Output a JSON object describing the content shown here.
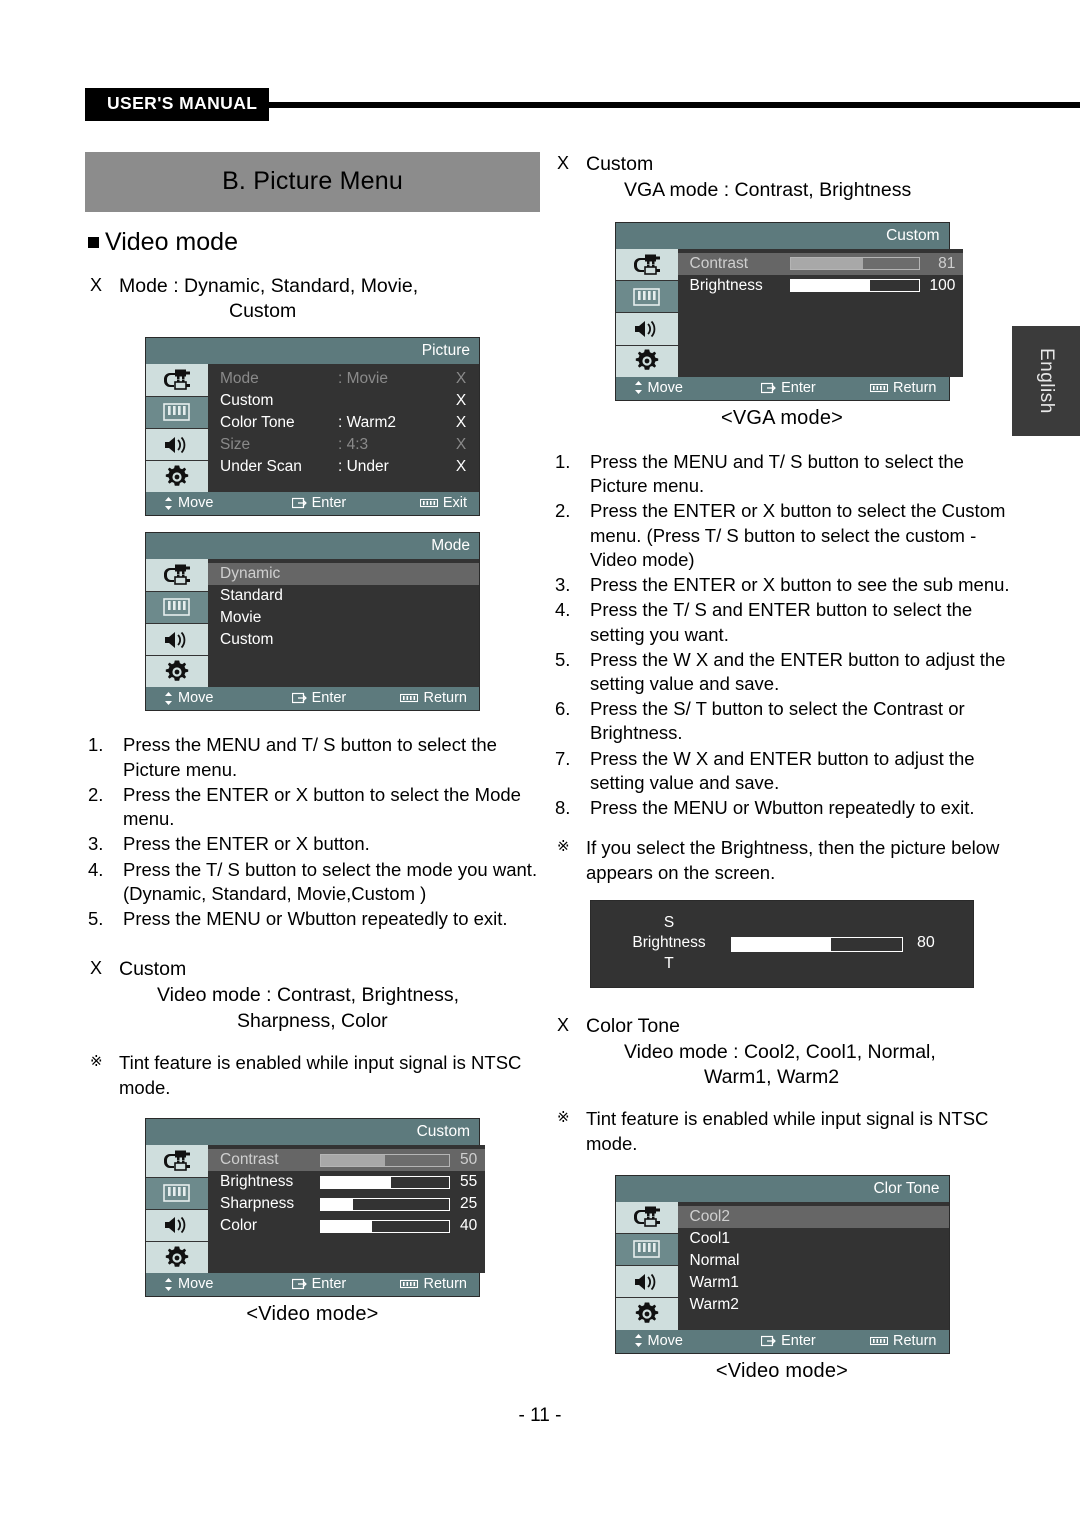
{
  "runhead": {
    "label": "USER'S MANUAL"
  },
  "language_tab": {
    "label": "English"
  },
  "page_number": "- 11 -",
  "left": {
    "band_title": "B. Picture Menu",
    "heading": "Video mode",
    "mode_bullet": {
      "marker": "X",
      "line1": "Mode : Dynamic, Standard, Movie,",
      "line2": "Custom"
    },
    "picture_menu": {
      "title": "Picture",
      "rows": [
        {
          "label": "Mode",
          "value": ": Movie",
          "arrow": "X"
        },
        {
          "label": "Custom",
          "value": "",
          "arrow": "X"
        },
        {
          "label": "Color Tone",
          "value": ": Warm2",
          "arrow": "X"
        },
        {
          "label": "Size",
          "value": ": 4:3",
          "arrow": "X"
        },
        {
          "label": "Under Scan",
          "value": ": Under",
          "arrow": "X"
        }
      ],
      "footer": {
        "move": "Move",
        "enter": "Enter",
        "last": "Exit"
      }
    },
    "mode_menu": {
      "title": "Mode",
      "items": [
        "Dynamic",
        "Standard",
        "Movie",
        "Custom"
      ],
      "footer": {
        "move": "Move",
        "enter": "Enter",
        "last": "Return"
      }
    },
    "steps": [
      {
        "num": "1.",
        "text": "Press the MENU and  T/ S button to select the Picture menu."
      },
      {
        "num": "2.",
        "text": "Press  the ENTER or X button to select the Mode menu."
      },
      {
        "num": "3.",
        "text": "Press  the ENTER or X button."
      },
      {
        "num": "4.",
        "text": "Press the  T/ S button to select the mode you want. (Dynamic, Standard, Movie,Custom )"
      },
      {
        "num": "5.",
        "text": "Press the MENU or  Wbutton repeatedly to exit."
      }
    ],
    "custom_bullet": {
      "marker": "X",
      "title": "Custom",
      "line1": "Video mode : Contrast, Brightness,",
      "line2": "Sharpness, Color"
    },
    "tint_note": {
      "marker": "※",
      "text": "Tint feature is enabled while input signal is NTSC mode."
    },
    "custom_menu": {
      "title": "Custom",
      "rows": [
        {
          "label": "Contrast",
          "value": "50",
          "percent": 50
        },
        {
          "label": "Brightness",
          "value": "55",
          "percent": 55
        },
        {
          "label": "Sharpness",
          "value": "25",
          "percent": 25
        },
        {
          "label": "Color",
          "value": "40",
          "percent": 40
        }
      ],
      "footer": {
        "move": "Move",
        "enter": "Enter",
        "last": "Return"
      }
    },
    "custom_caption": "<Video mode>"
  },
  "right": {
    "custom_bullet": {
      "marker": "X",
      "title": "Custom",
      "line1": "VGA mode : Contrast, Brightness"
    },
    "vga_menu": {
      "title": "Custom",
      "rows": [
        {
          "label": "Contrast",
          "value": "81",
          "percent": 57
        },
        {
          "label": "Brightness",
          "value": "100",
          "percent": 62
        }
      ],
      "footer": {
        "move": "Move",
        "enter": "Enter",
        "last": "Return"
      }
    },
    "vga_caption": "<VGA mode>",
    "steps": [
      {
        "num": "1.",
        "text": "Press the MENU and  T/ S button to select the Picture menu."
      },
      {
        "num": "2.",
        "text": "Press the ENTER or X button to select the Custom menu. (Press  T/ S button to select the custom - Video mode)"
      },
      {
        "num": "3.",
        "text": "Press the ENTER or X button to see the sub menu."
      },
      {
        "num": "4.",
        "text": "Press the  T/ S and ENTER button to select the setting you want."
      },
      {
        "num": "5.",
        "text": "Press the  W X and the ENTER button to adjust the setting value and save."
      },
      {
        "num": "6.",
        "text": "Press the  S/ T button to select the Contrast or Brightness."
      },
      {
        "num": "7.",
        "text": "Press the  W X and ENTER button to adjust the setting value and save."
      },
      {
        "num": "8.",
        "text": "Press the MENU or  Wbutton repeatedly to exit."
      }
    ],
    "bright_note": {
      "marker": "※",
      "text": "If you select the Brightness, then the picture below appears on the screen."
    },
    "brightness_popup": {
      "up": "S",
      "label": "Brightness",
      "down": "T",
      "value": "80",
      "percent": 58
    },
    "color_tone_bullet": {
      "marker": "X",
      "title": "Color Tone",
      "line1": "Video mode : Cool2, Cool1, Normal,",
      "line2": "Warm1, Warm2"
    },
    "tint_note": {
      "marker": "※",
      "text": "Tint feature is enabled while input signal is NTSC mode."
    },
    "color_tone_menu": {
      "title": "Clor Tone",
      "items": [
        "Cool2",
        "Cool1",
        "Normal",
        "Warm1",
        "Warm2"
      ],
      "footer": {
        "move": "Move",
        "enter": "Enter",
        "last": "Return"
      }
    },
    "color_tone_caption": "<Video mode>"
  },
  "icons": {
    "sidebar": [
      "input-plug-icon",
      "picture-bars-icon",
      "speaker-icon",
      "gear-icon"
    ],
    "footer": [
      "updown-arrow-icon",
      "enter-icon",
      "menu-bars-icon"
    ]
  },
  "colors": {
    "osd_header": "#5d7a7d",
    "osd_body": "#333333",
    "osd_sidebar": "#cfdedd",
    "osd_sidebar_selected": "#6d8a8c",
    "osd_highlight": "#666666",
    "band": "#8c8c8c",
    "runhead": "#000000"
  }
}
